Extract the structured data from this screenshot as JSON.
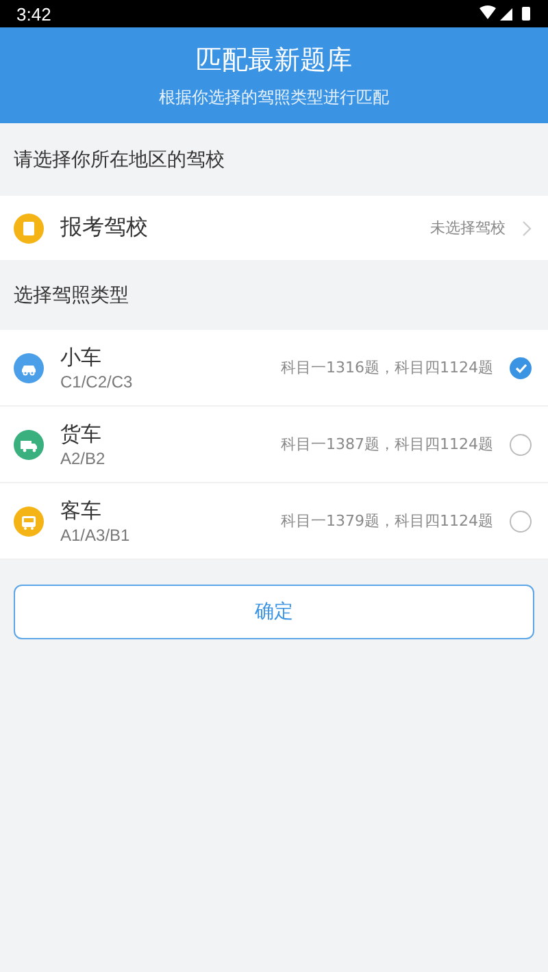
{
  "status_bar": {
    "time": "3:42"
  },
  "header": {
    "title": "匹配最新题库",
    "subtitle": "根据你选择的驾照类型进行匹配"
  },
  "region_label": "请选择你所在地区的驾校",
  "school": {
    "label": "报考驾校",
    "value": "未选择驾校"
  },
  "license_label": "选择驾照类型",
  "license_types": [
    {
      "kind": "car",
      "color": "#4a9fe8",
      "name": "小车",
      "codes": "C1/C2/C3",
      "counts": "科目一1316题，科目四1124题",
      "selected": true
    },
    {
      "kind": "truck",
      "color": "#3bb07f",
      "name": "货车",
      "codes": "A2/B2",
      "counts": "科目一1387题，科目四1124题",
      "selected": false
    },
    {
      "kind": "bus",
      "color": "#f5b416",
      "name": "客车",
      "codes": "A1/A3/B1",
      "counts": "科目一1379题，科目四1124题",
      "selected": false
    }
  ],
  "confirm_button": "确定"
}
